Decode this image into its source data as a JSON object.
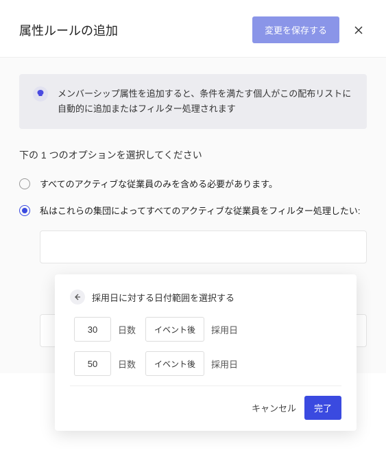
{
  "header": {
    "title": "属性ルールの追加",
    "save_label": "変更を保存する"
  },
  "info": {
    "text": "メンバーシップ属性を追加すると、条件を満たす個人がこの配布リストに自動的に追加またはフィルター処理されます"
  },
  "section_label": "下の 1 つのオプションを選択してください",
  "options": [
    {
      "label": "すべてのアクティブな従業員のみを含める必要があります。",
      "selected": false
    },
    {
      "label": "私はこれらの集団によってすべてのアクティブな従業員をフィルター処理したい:",
      "selected": true
    }
  ],
  "popup": {
    "title": "採用日に対する日付範囲を選択する",
    "rows": [
      {
        "value": "30",
        "days_label": "日数",
        "timing": "イベント後",
        "field": "採用日"
      },
      {
        "value": "50",
        "days_label": "日数",
        "timing": "イベント後",
        "field": "採用日"
      }
    ],
    "cancel_label": "キャンセル",
    "done_label": "完了"
  }
}
